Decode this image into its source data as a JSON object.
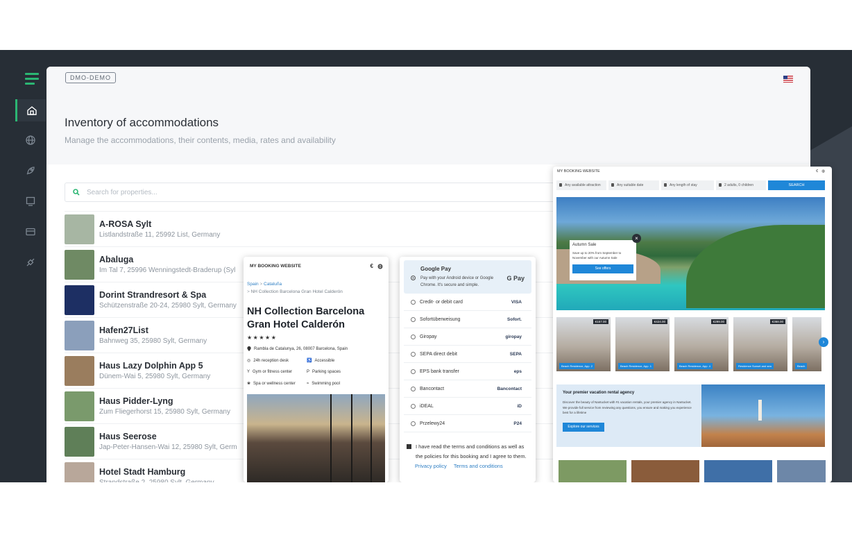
{
  "app": {
    "badge": "DMO-DEMO"
  },
  "rail": {
    "items": [
      "home-icon",
      "globe-icon",
      "rocket-icon",
      "monitor-icon",
      "card-icon",
      "plug-icon"
    ]
  },
  "page": {
    "title": "Inventory of accommodations",
    "subtitle": "Manage the accommodations, their contents, media, rates and availability"
  },
  "search": {
    "placeholder": "Search for properties..."
  },
  "properties": [
    {
      "name": "A-ROSA Sylt",
      "address": "Listlandstraße 11, 25992 List, Germany",
      "color": "#a7b6a3"
    },
    {
      "name": "Abaluga",
      "address": "Im Tal 7, 25996 Wenningstedt-Braderup (Syl",
      "color": "#6f8a64"
    },
    {
      "name": "Dorint Strandresort & Spa",
      "address": "Schützenstraße 20-24, 25980 Sylt, Germany",
      "color": "#1d2f63"
    },
    {
      "name": "Hafen27List",
      "address": "Bahnweg 35, 25980 Sylt, Germany",
      "color": "#8b9fbb"
    },
    {
      "name": "Haus Lazy Dolphin App 5",
      "address": "Dünem-Wai 5, 25980 Sylt, Germany",
      "color": "#9a7d5e"
    },
    {
      "name": "Haus Pidder-Lyng",
      "address": "Zum Fliegerhorst 15, 25980 Sylt, Germany",
      "color": "#7a9a6c"
    },
    {
      "name": "Haus Seerose",
      "address": "Jap-Peter-Hansen-Wai 12, 25980 Sylt, Germ",
      "color": "#5f7f58"
    },
    {
      "name": "Hotel Stadt Hamburg",
      "address": "Strandstraße 2, 25980 Sylt, Germany",
      "color": "#b8a79a"
    }
  ],
  "booking": {
    "site_title": "MY BOOKING WEBSITE",
    "currency": "€",
    "crumb_country": "Spain",
    "crumb_region": "Cataluña",
    "crumb_hotel": "NH Collection Barcelona Gran Hotel Calderón",
    "hotel_name": "NH Collection Barcelona Gran Hotel Calderón",
    "stars": "★★★★★",
    "address": "Rambla de Catalunya, 26, 08007 Barcelona, Spain",
    "facilities": [
      "24h reception desk",
      "Accessible",
      "Gym or fitness center",
      "Parking spaces",
      "Spa or wellness center",
      "Swimming pool"
    ]
  },
  "payment": {
    "google_pay_label": "Google Pay",
    "google_pay_desc": "Pay with your Android device or Google Chrome. It's secure and simple.",
    "google_pay_logo": "G Pay",
    "methods": [
      {
        "label": "Credit- or debit card",
        "logo": "VISA"
      },
      {
        "label": "Sofortüberweisung",
        "logo": "Sofort."
      },
      {
        "label": "Giropay",
        "logo": "giropay"
      },
      {
        "label": "SEPA direct debit",
        "logo": "SEPA"
      },
      {
        "label": "EPS bank transfer",
        "logo": "eps"
      },
      {
        "label": "Bancontact",
        "logo": "Bancontact"
      },
      {
        "label": "iDEAL",
        "logo": "iD"
      },
      {
        "label": "Przelewy24",
        "logo": "P24"
      }
    ],
    "terms": "I have read the terms and conditions as well as the policies for this booking and I agree to them.",
    "privacy_link": "Privacy policy",
    "terms_link": "Terms and conditions"
  },
  "website": {
    "title": "MY BOOKING WEBSITE",
    "currency": "€",
    "filters": [
      "Any available attraction",
      "Any suitable date",
      "Any length of stay",
      "2 adults, 0 children"
    ],
    "search_label": "SEARCH",
    "sale": {
      "title": "Autumn Sale",
      "desc": "Save up to 20% from September to November with our Autumn Sale",
      "button": "See offers"
    },
    "rentals": [
      {
        "price": "€157.00",
        "tag": "Beach Residence, App. 2"
      },
      {
        "price": "€424.00",
        "tag": "Beach Residence, App. 1"
      },
      {
        "price": "€299.00",
        "tag": "Beach Residence, App. 4"
      },
      {
        "price": "€368.00",
        "tag": "Residence Sunset and sea"
      },
      {
        "price": "",
        "tag": "Beach"
      }
    ],
    "agency": {
      "title": "Your premier vacation rental agency",
      "desc": "Discover the beauty of Nantucket with #1 vacation rentals, your premier agency in Nantucket. We provide full service from reviewing any questions, you ensure and making you experience best for a lifetime",
      "button": "Explore our services"
    }
  }
}
